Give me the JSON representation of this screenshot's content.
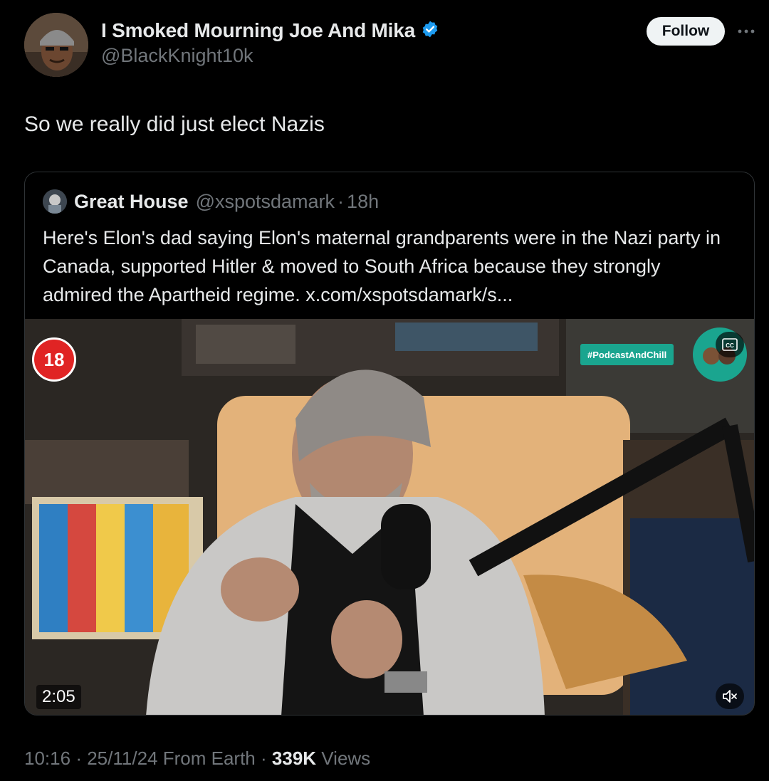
{
  "author": {
    "display_name": "I Smoked Mourning Joe And Mika",
    "handle": "@BlackKnight10k",
    "verified_icon": "verified-badge-icon",
    "avatar_icon": "avatar"
  },
  "header": {
    "follow_label": "Follow",
    "more_icon": "more-horizontal-icon"
  },
  "tweet": {
    "text": "So we really did just elect Nazis"
  },
  "quote": {
    "display_name": "Great House",
    "handle": "@xspotsdamark",
    "separator": "·",
    "time_ago": "18h",
    "text": "Here's Elon's dad saying Elon's maternal grandparents were in the Nazi party in Canada, supported Hitler & moved to South Africa because they strongly admired the Apartheid regime. x.com/xspotsdamark/s..."
  },
  "video": {
    "age_rating": "18",
    "podcast_tag": "#PodcastAndChill",
    "duration": "2:05",
    "cc_icon": "closed-captions-icon",
    "mute_icon": "muted-speaker-icon"
  },
  "meta": {
    "time": "10:16",
    "sep1": "·",
    "date": "25/11/24",
    "source": "From Earth",
    "sep2": "·",
    "views_count": "339K",
    "views_label": "Views"
  },
  "colors": {
    "background": "#000000",
    "text_primary": "#e7e9ea",
    "text_secondary": "#71767b",
    "verified_blue": "#1d9bf0",
    "card_border": "#2f3336"
  }
}
